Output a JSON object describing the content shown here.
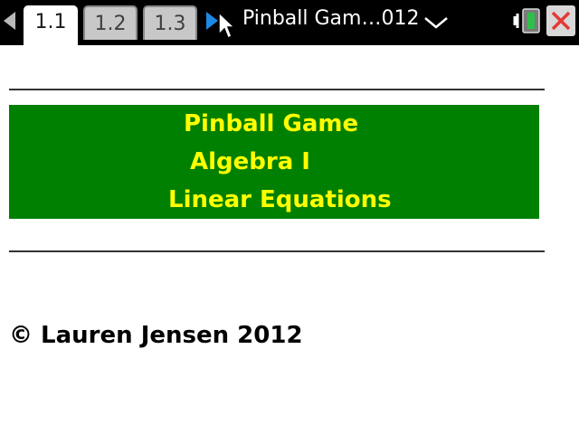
{
  "tabs": [
    {
      "label": "1.1",
      "active": true
    },
    {
      "label": "1.2",
      "active": false
    },
    {
      "label": "1.3",
      "active": false
    }
  ],
  "document_title": "Pinball Gam…012",
  "icons": {
    "nav_left": "left-arrow-icon",
    "nav_right": "right-arrow-icon",
    "dropdown": "chevron-down-icon",
    "battery": "battery-icon",
    "close": "close-icon",
    "cursor": "mouse-pointer-icon"
  },
  "content": {
    "title_lines": [
      "Pinball Game",
      "Algebra I",
      "Linear Equations"
    ],
    "copyright": "© Lauren Jensen 2012"
  },
  "colors": {
    "banner_bg": "#008000",
    "banner_text": "#ffff00",
    "close_x": "#e53935",
    "nav_right": "#1e88e5"
  }
}
